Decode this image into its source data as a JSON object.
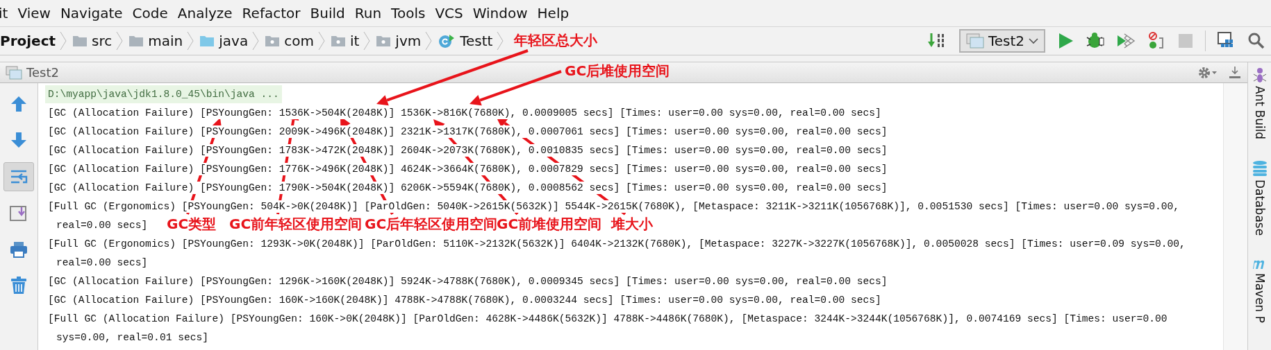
{
  "menu": [
    {
      "label": "it"
    },
    {
      "label": "View"
    },
    {
      "label": "Navigate"
    },
    {
      "label": "Code"
    },
    {
      "label": "Analyze"
    },
    {
      "label": "Refactor"
    },
    {
      "label": "Build"
    },
    {
      "label": "Run"
    },
    {
      "label": "Tools"
    },
    {
      "label": "VCS"
    },
    {
      "label": "Window"
    },
    {
      "label": "Help"
    }
  ],
  "breadcrumbs": [
    {
      "label": "Project",
      "kind": "project"
    },
    {
      "label": "src",
      "kind": "folder"
    },
    {
      "label": "main",
      "kind": "folder"
    },
    {
      "label": "java",
      "kind": "source"
    },
    {
      "label": "com",
      "kind": "package"
    },
    {
      "label": "it",
      "kind": "package"
    },
    {
      "label": "jvm",
      "kind": "package"
    },
    {
      "label": "Testt",
      "kind": "class"
    }
  ],
  "run_config": {
    "label": "Test2"
  },
  "stop_button": {
    "disabled": true
  },
  "tool_window": {
    "title": "Test2"
  },
  "side_toolbar": [
    {
      "kind": "up",
      "selected": false
    },
    {
      "kind": "down",
      "selected": false
    },
    {
      "kind": "wrap",
      "selected": true
    },
    {
      "kind": "scroll",
      "selected": false
    },
    {
      "kind": "print",
      "selected": false
    },
    {
      "kind": "clear",
      "selected": false
    }
  ],
  "console": {
    "lines": [
      {
        "kind": "command",
        "text": "D:\\myapp\\java\\jdk1.8.0_45\\bin\\java ..."
      },
      {
        "kind": "output",
        "text": "[GC (Allocation Failure) [PSYoungGen: 1536K->504K(2048K)] 1536K->816K(7680K), 0.0009005 secs] [Times: user=0.00 sys=0.00, real=0.00 secs]"
      },
      {
        "kind": "output",
        "text": "[GC (Allocation Failure) [PSYoungGen: 2009K->496K(2048K)] 2321K->1317K(7680K), 0.0007061 secs] [Times: user=0.00 sys=0.00, real=0.00 secs]"
      },
      {
        "kind": "output",
        "text": "[GC (Allocation Failure) [PSYoungGen: 1783K->472K(2048K)] 2604K->2073K(7680K), 0.0010835 secs] [Times: user=0.00 sys=0.00, real=0.00 secs]"
      },
      {
        "kind": "output",
        "text": "[GC (Allocation Failure) [PSYoungGen: 1776K->496K(2048K)] 4624K->3664K(7680K), 0.0007829 secs] [Times: user=0.00 sys=0.00, real=0.00 secs]"
      },
      {
        "kind": "output",
        "text": "[GC (Allocation Failure) [PSYoungGen: 1790K->504K(2048K)] 6206K->5594K(7680K), 0.0008562 secs] [Times: user=0.00 sys=0.00, real=0.00 secs]"
      },
      {
        "kind": "output",
        "text": "[Full GC (Ergonomics) [PSYoungGen: 504K->0K(2048K)] [ParOldGen: 5040K->2615K(5632K)] 5544K->2615K(7680K), [Metaspace: 3211K->3211K(1056768K)], 0.0051530 secs] [Times: user=0.00 sys=0.00,",
        "continuation": "real=0.00 secs]"
      },
      {
        "kind": "output",
        "text": "[Full GC (Ergonomics) [PSYoungGen: 1293K->0K(2048K)] [ParOldGen: 5110K->2132K(5632K)] 6404K->2132K(7680K), [Metaspace: 3227K->3227K(1056768K)], 0.0050028 secs] [Times: user=0.09 sys=0.00,",
        "continuation": "real=0.00 secs]"
      },
      {
        "kind": "output",
        "text": "[GC (Allocation Failure) [PSYoungGen: 1296K->160K(2048K)] 5924K->4788K(7680K), 0.0009345 secs] [Times: user=0.00 sys=0.00, real=0.00 secs]"
      },
      {
        "kind": "output",
        "text": "[GC (Allocation Failure) [PSYoungGen: 160K->160K(2048K)] 4788K->4788K(7680K), 0.0003244 secs] [Times: user=0.00 sys=0.00, real=0.00 secs]"
      },
      {
        "kind": "output",
        "text": "[Full GC (Allocation Failure) [PSYoungGen: 160K->0K(2048K)] [ParOldGen: 4628K->4486K(5632K)] 4788K->4486K(7680K), [Metaspace: 3244K->3244K(1056768K)], 0.0074169 secs] [Times: user=0.00",
        "continuation": "sys=0.00, real=0.01 secs]"
      }
    ]
  },
  "right_tool_strip": [
    {
      "label": "Ant Build",
      "kind": "ant"
    },
    {
      "label": "Database",
      "kind": "database"
    },
    {
      "label": "Maven P",
      "kind": "maven"
    }
  ],
  "annotations": [
    {
      "text": "年轻区总大小"
    },
    {
      "text": "GC后堆使用空间"
    },
    {
      "text": "GC类型"
    },
    {
      "text": "GC前年轻区使用空间"
    },
    {
      "text": "GC后年轻区使用空间"
    },
    {
      "text": "GC前堆使用空间"
    },
    {
      "text": "堆大小"
    }
  ]
}
